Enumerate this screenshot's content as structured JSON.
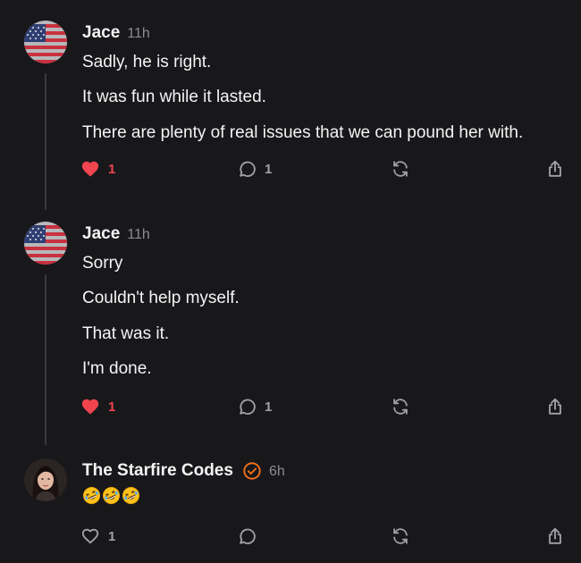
{
  "posts": [
    {
      "author": "Jace",
      "time": "11h",
      "paragraphs": [
        "Sadly, he is right.",
        "It was fun while it lasted.",
        "There are plenty of real issues that we can pound her with."
      ],
      "likes": "1",
      "liked": true,
      "replies": "1"
    },
    {
      "author": "Jace",
      "time": "11h",
      "paragraphs": [
        "Sorry",
        "Couldn't help myself.",
        "That was it.",
        "I'm done."
      ],
      "likes": "1",
      "liked": true,
      "replies": "1"
    },
    {
      "author": "The Starfire Codes",
      "time": "6h",
      "verified": true,
      "content_icons": [
        "rofl-emoji",
        "rofl-emoji",
        "rofl-emoji"
      ],
      "likes": "1",
      "liked": false,
      "replies": ""
    }
  ],
  "colors": {
    "background": "#18181b",
    "text": "#f4f4f5",
    "muted": "#8b8b92",
    "like_red": "#f0444f",
    "verified_orange": "#f97316"
  }
}
